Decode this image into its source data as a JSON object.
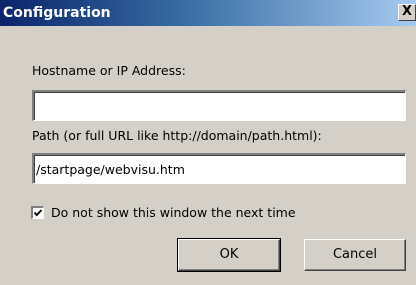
{
  "window": {
    "title": "Configuration",
    "close_label": "X"
  },
  "hostname": {
    "label": "Hostname or IP Address:",
    "value": ""
  },
  "path": {
    "label": "Path (or full URL like http://domain/path.html):",
    "value": "/startpage/webvisu.htm"
  },
  "checkbox": {
    "label": "Do not show this window the next time",
    "checked": true
  },
  "buttons": {
    "ok": "OK",
    "cancel": "Cancel"
  }
}
